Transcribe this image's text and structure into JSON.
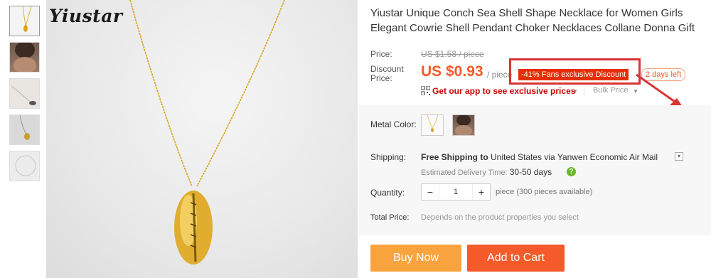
{
  "brand": "Yiustar",
  "product": {
    "title": "Yiustar Unique Conch Sea Shell Shape Necklace for Women Girls Elegant Cowrie Shell Pendant Choker Necklaces Collane Donna Gift"
  },
  "price": {
    "label": "Price:",
    "original": "US $1.58 / piece",
    "discount_label_1": "Discount",
    "discount_label_2": "Price:",
    "current": "US $0.93",
    "unit": "/ piece",
    "badge": "-41% Fans exclusive Discount",
    "days_left": "2 days left",
    "app_link": "Get our app to see exclusive prices",
    "bulk": "Bulk Price"
  },
  "options": {
    "metal_label": "Metal Color:"
  },
  "shipping": {
    "label": "Shipping:",
    "free": "Free Shipping to",
    "destination": "United States via Yanwen Economic Air Mail",
    "est_label": "Estimated Delivery Time:",
    "est_value": "30-50 days"
  },
  "quantity": {
    "label": "Quantity:",
    "value": "1",
    "minus": "−",
    "plus": "+",
    "available": "piece (300 pieces available)"
  },
  "total": {
    "label": "Total Price:",
    "text": "Depends on the product properties you select"
  },
  "actions": {
    "buy_now": "Buy Now",
    "add_to_cart": "Add to Cart"
  },
  "colors": {
    "accent": "#f45a2a",
    "buy": "#f9a33f",
    "highlight_box": "#d93434",
    "gold": "#d9a520"
  }
}
